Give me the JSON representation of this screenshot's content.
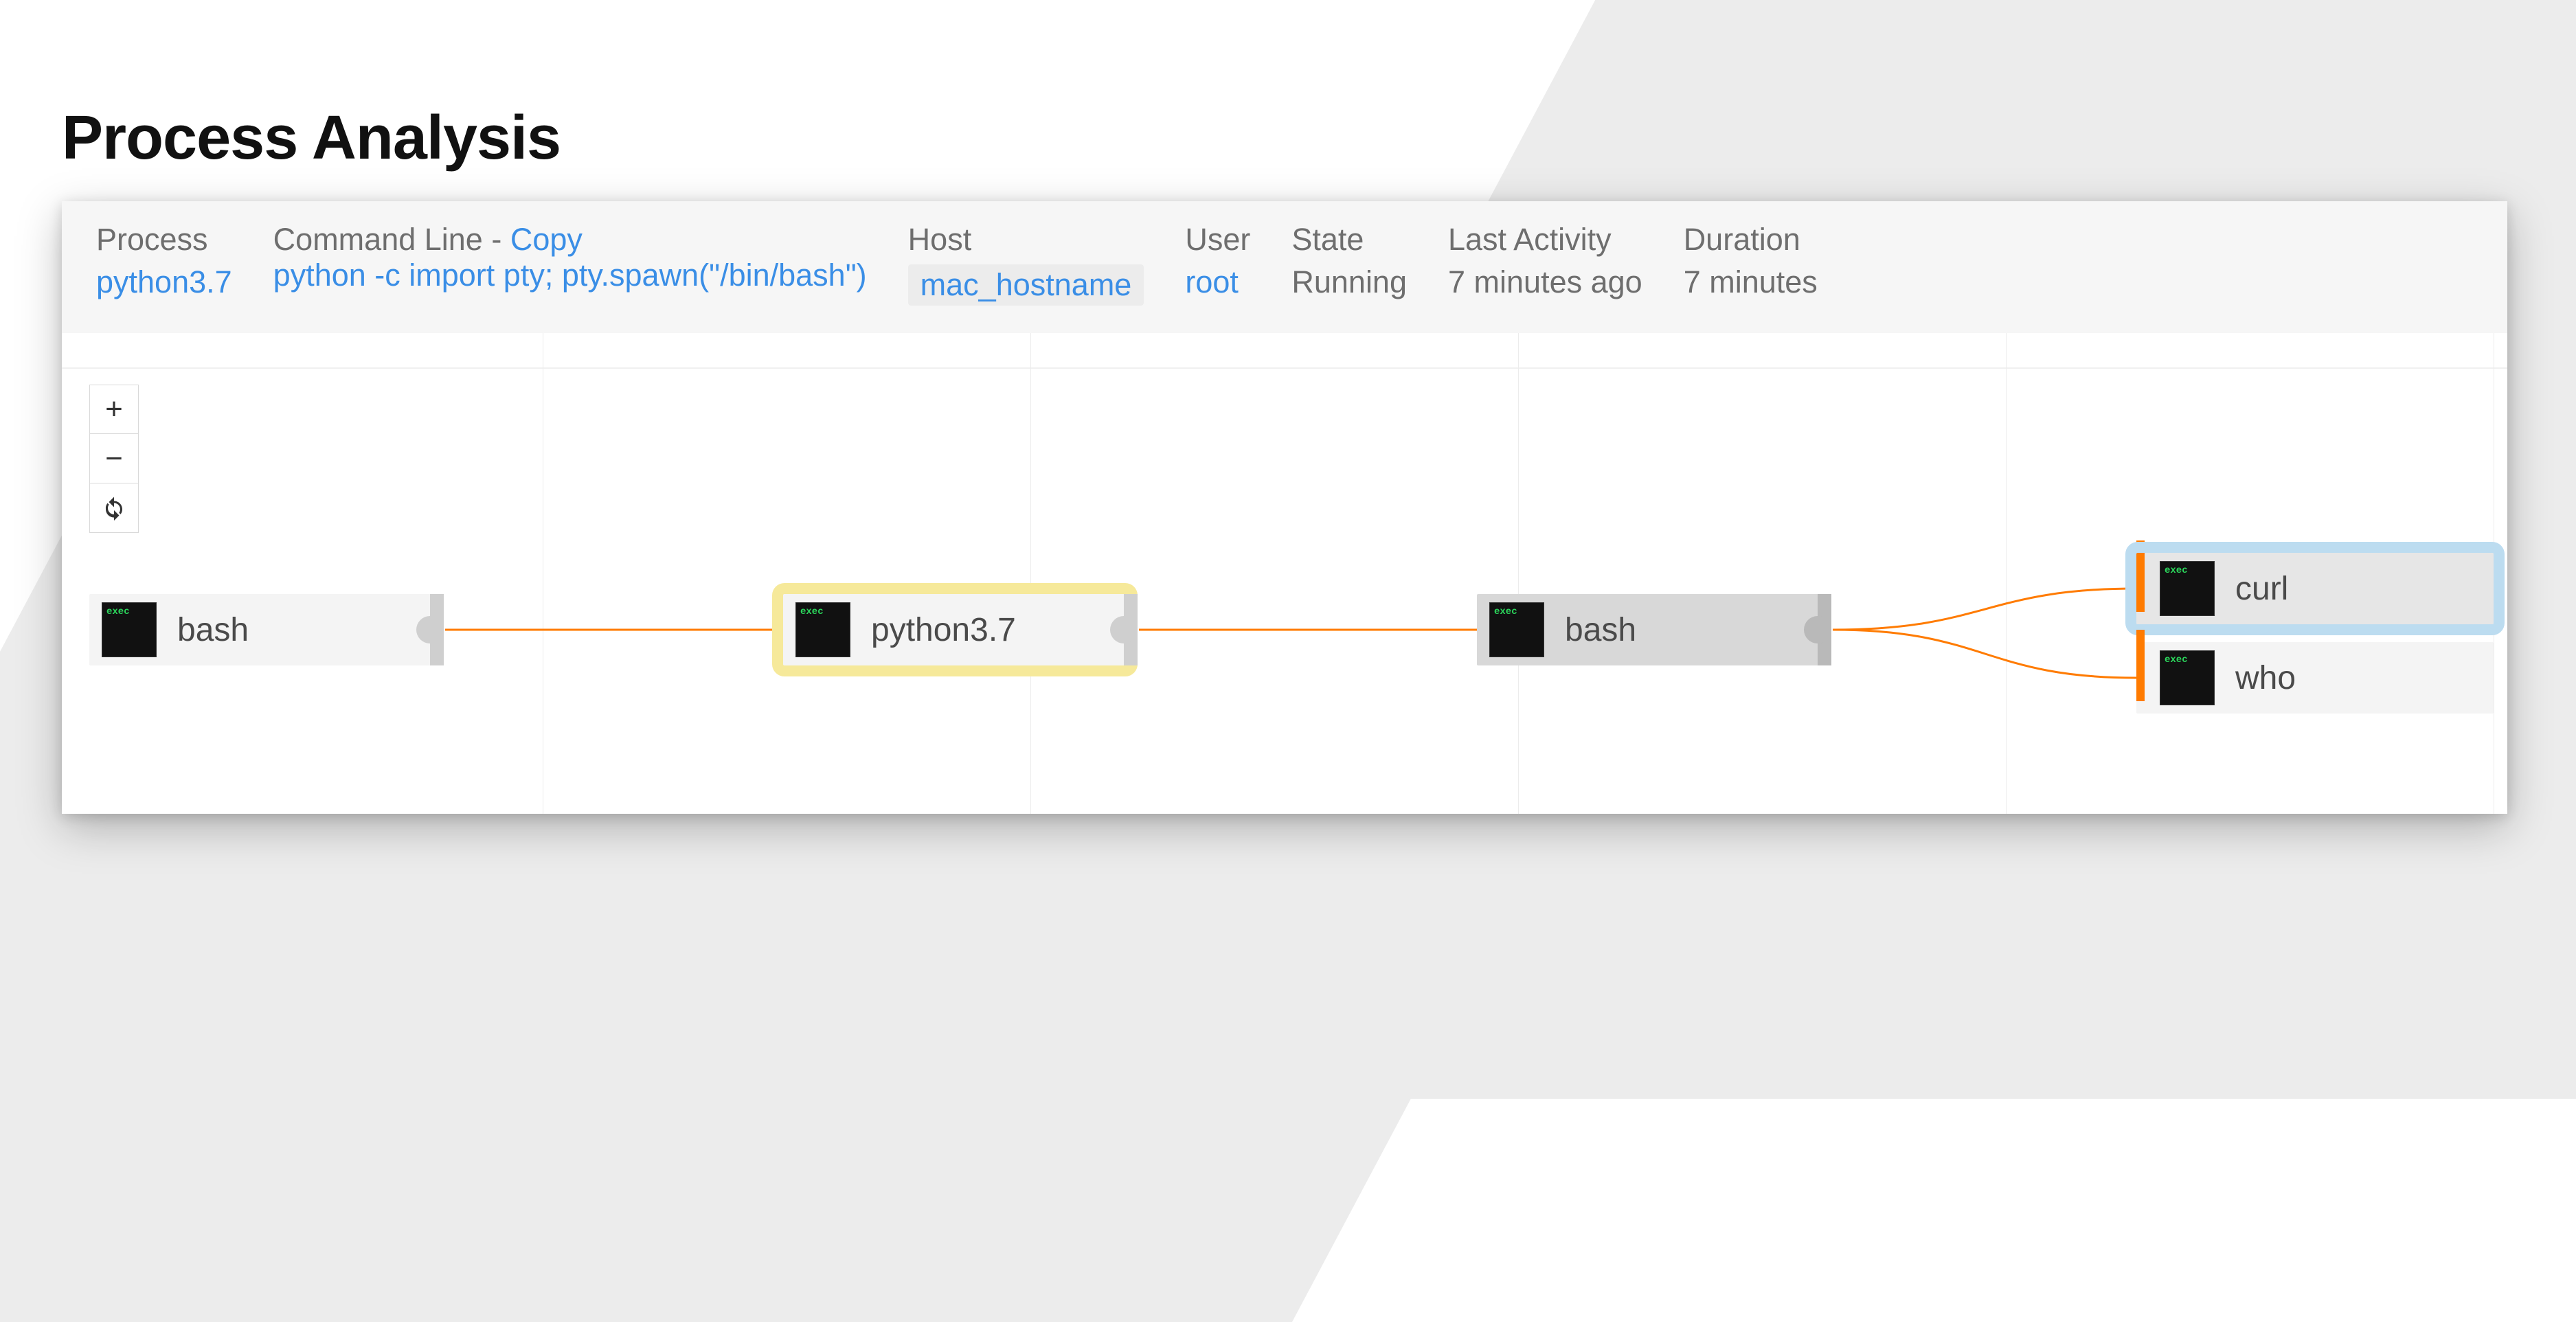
{
  "title": "Process Analysis",
  "info": {
    "process": {
      "label": "Process",
      "value": "python3.7"
    },
    "command": {
      "label": "Command Line - ",
      "copy": "Copy",
      "value": "python -c import pty; pty.spawn(\"/bin/bash\")"
    },
    "host": {
      "label": "Host",
      "value": "mac_hostname"
    },
    "user": {
      "label": "User",
      "value": "root"
    },
    "state": {
      "label": "State",
      "value": "Running"
    },
    "last": {
      "label": "Last Activity",
      "value": "7 minutes ago"
    },
    "duration": {
      "label": "Duration",
      "value": "7 minutes"
    }
  },
  "zoom": {
    "in": "+",
    "out": "−"
  },
  "nodes": {
    "bash1": "bash",
    "python": "python3.7",
    "bash2": "bash",
    "curl": "curl",
    "who": "who"
  },
  "icons": {
    "refresh": "refresh-icon"
  }
}
